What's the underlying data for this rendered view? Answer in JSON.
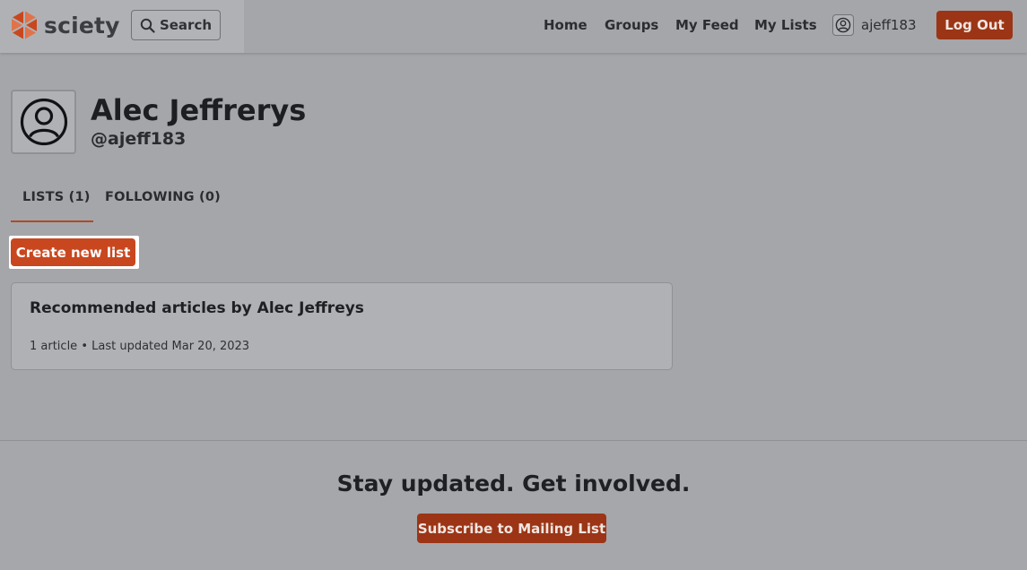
{
  "header": {
    "logo_text": "sciety",
    "search_label": "Search",
    "nav": [
      {
        "label": "Home"
      },
      {
        "label": "Groups"
      },
      {
        "label": "My Feed"
      },
      {
        "label": "My Lists"
      }
    ],
    "user": {
      "name": "ajeff183",
      "icon": "user-circle-icon"
    },
    "logout_label": "Log Out"
  },
  "profile": {
    "name": "Alec Jeffrerys",
    "handle": "@ajeff183",
    "avatar_icon": "user-circle-icon"
  },
  "tabs": [
    {
      "label": "LISTS (1)",
      "active": true
    },
    {
      "label": "FOLLOWING (0)",
      "active": false
    }
  ],
  "create_list_label": "Create new list",
  "lists": [
    {
      "title": "Recommended articles by Alec Jeffreys",
      "meta": "1 article • Last updated Mar 20, 2023"
    }
  ],
  "footer": {
    "heading": "Stay updated. Get involved.",
    "subscribe_label": "Subscribe to Mailing List"
  },
  "colors": {
    "accent": "#c9471f",
    "dark_accent": "#9b3516",
    "tab_underline": "#b24a26"
  }
}
